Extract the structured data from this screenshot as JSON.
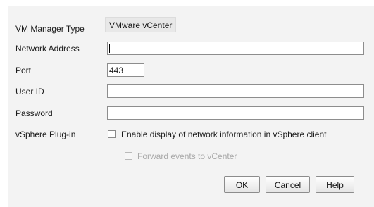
{
  "form": {
    "vm_manager_type": {
      "label": "VM Manager Type",
      "value": "VMware vCenter"
    },
    "network_address": {
      "label": "Network Address",
      "value": ""
    },
    "port": {
      "label": "Port",
      "value": "443"
    },
    "user_id": {
      "label": "User ID",
      "value": ""
    },
    "password": {
      "label": "Password",
      "value": ""
    },
    "vsphere_plugin": {
      "label": "vSphere Plug-in",
      "enable_display": {
        "label": "Enable display of network information in vSphere client",
        "checked": false
      },
      "forward_events": {
        "label": "Forward events to vCenter",
        "checked": false,
        "disabled": true
      }
    }
  },
  "buttons": {
    "ok": "OK",
    "cancel": "Cancel",
    "help": "Help"
  }
}
